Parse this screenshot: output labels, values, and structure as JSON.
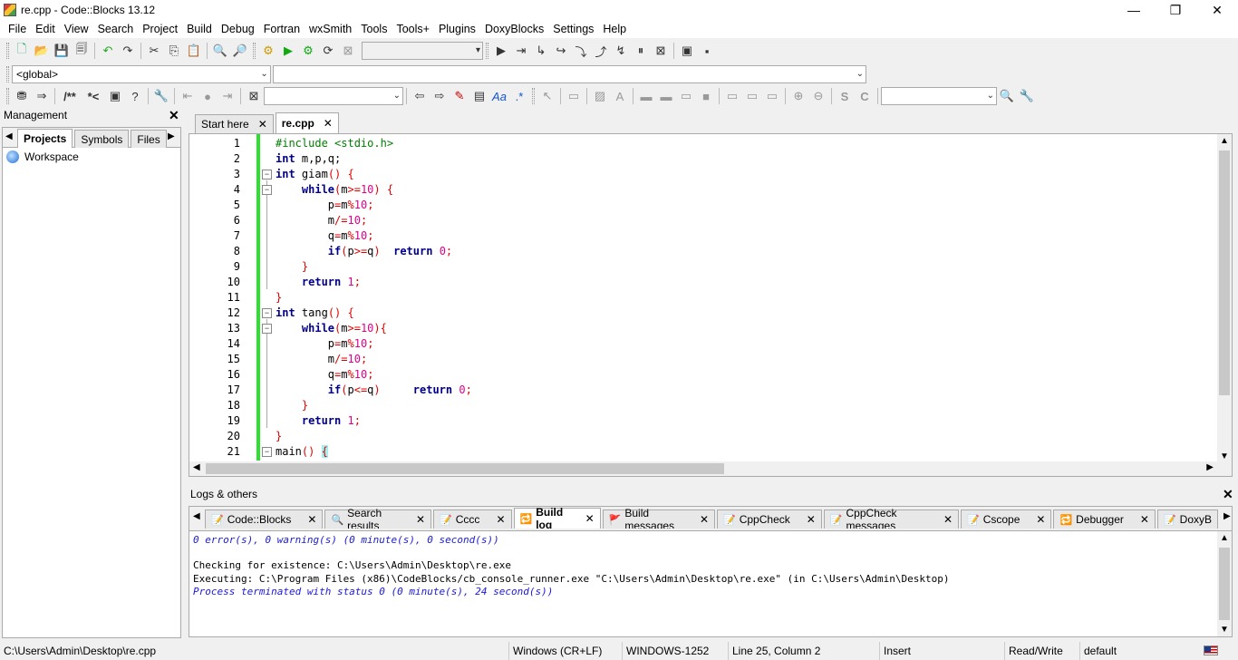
{
  "window": {
    "title": "re.cpp - Code::Blocks 13.12",
    "minimize": "—",
    "restore": "❐",
    "close": "✕"
  },
  "menu": [
    "File",
    "Edit",
    "View",
    "Search",
    "Project",
    "Build",
    "Debug",
    "Fortran",
    "wxSmith",
    "Tools",
    "Tools+",
    "Plugins",
    "DoxyBlocks",
    "Settings",
    "Help"
  ],
  "scope_combo": {
    "value": "<global>",
    "value2": ""
  },
  "management": {
    "title": "Management",
    "tabs": [
      "Projects",
      "Symbols",
      "Files"
    ],
    "workspace": "Workspace"
  },
  "editor_tabs": [
    {
      "label": "Start here",
      "active": false
    },
    {
      "label": "re.cpp",
      "active": true
    }
  ],
  "code": {
    "lines": [
      {
        "n": "1",
        "html": "<span class=\"p\">#include &lt;stdio.h&gt;</span>"
      },
      {
        "n": "2",
        "html": "<span class=\"k\">int</span> m,p,q;"
      },
      {
        "n": "3",
        "html": "<span class=\"k\">int</span> giam<span class=\"o\">()</span> <span class=\"o\">{</span>"
      },
      {
        "n": "4",
        "html": "    <span class=\"k\">while</span><span class=\"o\">(</span>m<span class=\"o\">&gt;=</span><span class=\"n\">10</span><span class=\"o\">)</span> <span class=\"o\">{</span>"
      },
      {
        "n": "5",
        "html": "        p<span class=\"o\">=</span>m<span class=\"o\">%</span><span class=\"n\">10</span><span class=\"o\">;</span>"
      },
      {
        "n": "6",
        "html": "        m<span class=\"o\">/=</span><span class=\"n\">10</span><span class=\"o\">;</span>"
      },
      {
        "n": "7",
        "html": "        q<span class=\"o\">=</span>m<span class=\"o\">%</span><span class=\"n\">10</span><span class=\"o\">;</span>"
      },
      {
        "n": "8",
        "html": "        <span class=\"k\">if</span><span class=\"o\">(</span>p<span class=\"o\">&gt;=</span>q<span class=\"o\">)</span>  <span class=\"k\">return</span> <span class=\"n\">0</span><span class=\"o\">;</span>"
      },
      {
        "n": "9",
        "html": "    <span class=\"o\">}</span>"
      },
      {
        "n": "10",
        "html": "    <span class=\"k\">return</span> <span class=\"n\">1</span><span class=\"o\">;</span>"
      },
      {
        "n": "11",
        "html": "<span class=\"o\">}</span>"
      },
      {
        "n": "12",
        "html": "<span class=\"k\">int</span> tang<span class=\"o\">()</span> <span class=\"o\">{</span>"
      },
      {
        "n": "13",
        "html": "    <span class=\"k\">while</span><span class=\"o\">(</span>m<span class=\"o\">&gt;=</span><span class=\"n\">10</span><span class=\"o\">){</span>"
      },
      {
        "n": "14",
        "html": "        p<span class=\"o\">=</span>m<span class=\"o\">%</span><span class=\"n\">10</span><span class=\"o\">;</span>"
      },
      {
        "n": "15",
        "html": "        m<span class=\"o\">/=</span><span class=\"n\">10</span><span class=\"o\">;</span>"
      },
      {
        "n": "16",
        "html": "        q<span class=\"o\">=</span>m<span class=\"o\">%</span><span class=\"n\">10</span><span class=\"o\">;</span>"
      },
      {
        "n": "17",
        "html": "        <span class=\"k\">if</span><span class=\"o\">(</span>p<span class=\"o\">&lt;=</span>q<span class=\"o\">)</span>     <span class=\"k\">return</span> <span class=\"n\">0</span><span class=\"o\">;</span>"
      },
      {
        "n": "18",
        "html": "    <span class=\"o\">}</span>"
      },
      {
        "n": "19",
        "html": "    <span class=\"k\">return</span> <span class=\"n\">1</span><span class=\"o\">;</span>"
      },
      {
        "n": "20",
        "html": "<span class=\"o\">}</span>"
      },
      {
        "n": "21",
        "html": "main<span class=\"o\">()</span> <span class=\"o\" style=\"background:#a0f0f0\">{</span>"
      }
    ]
  },
  "logs": {
    "title": "Logs & others",
    "tabs": [
      {
        "label": "Code::Blocks",
        "active": false
      },
      {
        "label": "Search results",
        "active": false
      },
      {
        "label": "Cccc",
        "active": false
      },
      {
        "label": "Build log",
        "active": true
      },
      {
        "label": "Build messages",
        "active": false
      },
      {
        "label": "CppCheck",
        "active": false
      },
      {
        "label": "CppCheck messages",
        "active": false
      },
      {
        "label": "Cscope",
        "active": false
      },
      {
        "label": "Debugger",
        "active": false
      },
      {
        "label": "DoxyB",
        "active": false
      }
    ],
    "lines": [
      {
        "text": "0 error(s), 0 warning(s) (0 minute(s), 0 second(s))",
        "style": "blue-it"
      },
      {
        "text": "",
        "style": ""
      },
      {
        "text": "Checking for existence: C:\\Users\\Admin\\Desktop\\re.exe",
        "style": ""
      },
      {
        "text": "Executing: C:\\Program Files (x86)\\CodeBlocks/cb_console_runner.exe \"C:\\Users\\Admin\\Desktop\\re.exe\" (in C:\\Users\\Admin\\Desktop)",
        "style": ""
      },
      {
        "text": "Process terminated with status 0 (0 minute(s), 24 second(s))",
        "style": "blue-it"
      }
    ]
  },
  "status": {
    "path": "C:\\Users\\Admin\\Desktop\\re.cpp",
    "eol": "Windows (CR+LF)",
    "encoding": "WINDOWS-1252",
    "position": "Line 25, Column 2",
    "mode": "Insert",
    "access": "Read/Write",
    "profile": "default"
  }
}
